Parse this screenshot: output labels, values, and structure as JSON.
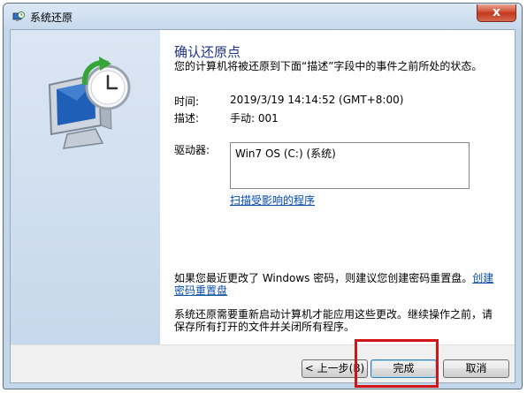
{
  "window": {
    "title": "系统还原",
    "close_glyph": "x"
  },
  "content": {
    "heading": "确认还原点",
    "subtitle": "您的计算机将被还原到下面“描述”字段中的事件之前所处的状态。",
    "time_label": "时间:",
    "time_value": "2019/3/19 14:14:52 (GMT+8:00)",
    "desc_label": "描述:",
    "desc_value": "手动: 001",
    "drives_label": "驱动器:",
    "drives_items": [
      "Win7 OS (C:) (系统)"
    ],
    "scan_link": "扫描受影响的程序",
    "password_text": "如果您最近更改了 Windows 密码，则建议您创建密码重置盘。",
    "password_link": "创建密码重置盘",
    "restart_text": "系统还原需要重新启动计算机才能应用这些更改。继续操作之前，请保存所有打开的文件并关闭所有程序。"
  },
  "buttons": {
    "back": "< 上一步(B)",
    "finish": "完成",
    "cancel": "取消"
  },
  "colors": {
    "heading": "#1e3287",
    "link": "#0b4fa8",
    "highlight": "#d11414"
  }
}
